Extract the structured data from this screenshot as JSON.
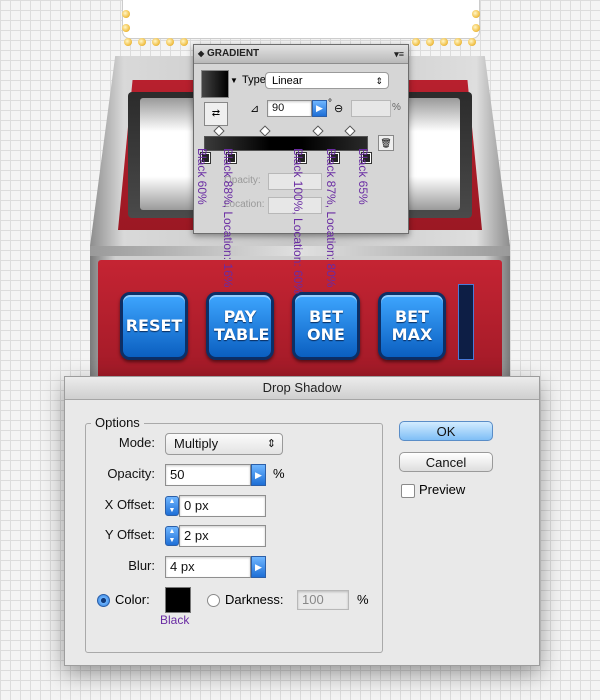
{
  "gradient_panel": {
    "title": "GRADIENT",
    "type_label": "Type",
    "type_value": "Linear",
    "angle_value": "90",
    "degree_symbol": "°",
    "aspect_symbol": "%",
    "opacity_label": "Opacity:",
    "location_label": "Location:",
    "stop_annotations": [
      "Black 60%",
      "Black 88%, Location: 16%",
      "Black 100%, Location: 60%",
      "Black 87%, Location: 80%",
      "Black 65%"
    ]
  },
  "slot_machine": {
    "buttons": [
      "RESET",
      "PAY TABLE",
      "BET ONE",
      "BET MAX"
    ]
  },
  "dialog": {
    "title": "Drop Shadow",
    "options_legend": "Options",
    "mode_label": "Mode:",
    "mode_value": "Multiply",
    "opacity_label": "Opacity:",
    "opacity_value": "50",
    "opacity_unit": "%",
    "x_offset_label": "X Offset:",
    "x_offset_value": "0 px",
    "y_offset_label": "Y Offset:",
    "y_offset_value": "2 px",
    "blur_label": "Blur:",
    "blur_value": "4 px",
    "color_label": "Color:",
    "color_swatch": "#000000",
    "color_annotation": "Black",
    "darkness_label": "Darkness:",
    "darkness_value": "100",
    "darkness_unit": "%",
    "ok_label": "OK",
    "cancel_label": "Cancel",
    "preview_label": "Preview",
    "preview_checked": false,
    "color_radio_selected": true
  },
  "colors": {
    "annotation": "#6a2ca3",
    "cabinet_red": "#b8202e",
    "button_blue": "#1e6fd6"
  }
}
